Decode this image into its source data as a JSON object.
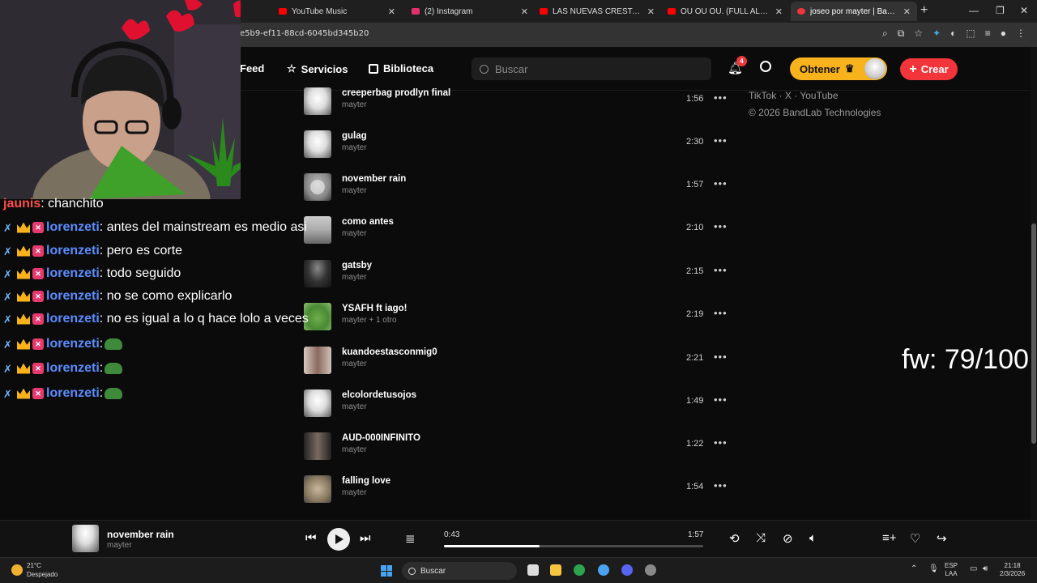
{
  "browser": {
    "tabs": [
      {
        "title": "YouTube Music",
        "color": "#ff0000"
      },
      {
        "title": "(2) Instagram",
        "color": "#e1306c"
      },
      {
        "title": "LAS NUEVAS CRESTAS (TEENX",
        "color": "#ff0000"
      },
      {
        "title": "OU OU OU. (FULL ALBUM) - Yo",
        "color": "#ff0000"
      },
      {
        "title": "joseo por mayter | BandLab",
        "color": "#f2353a"
      }
    ],
    "url": "e5b9-ef11-88cd-6045bd345b20"
  },
  "header": {
    "nav": {
      "feed": "Feed",
      "services": "Servicios",
      "library": "Biblioteca"
    },
    "search_placeholder": "Buscar",
    "notification_count": "4",
    "get_label": "Obtener",
    "create_label": "Crear"
  },
  "footer": {
    "links": "TikTok · X · YouTube",
    "copyright": "© 2026 BandLab Technologies"
  },
  "tracks": [
    {
      "name": "creeperbag prodlyn final",
      "artist": "mayter",
      "duration": "1:56"
    },
    {
      "name": "gulag",
      "artist": "mayter",
      "duration": "2:30"
    },
    {
      "name": "november rain",
      "artist": "mayter",
      "duration": "1:57"
    },
    {
      "name": "como antes",
      "artist": "mayter",
      "duration": "2:10"
    },
    {
      "name": "gatsby",
      "artist": "mayter",
      "duration": "2:15"
    },
    {
      "name": "YSAFH ft iago!",
      "artist": "mayter + 1 otro",
      "duration": "2:19"
    },
    {
      "name": "kuandoestasconmig0",
      "artist": "mayter",
      "duration": "2:21"
    },
    {
      "name": "elcolordetusojos",
      "artist": "mayter",
      "duration": "1:49"
    },
    {
      "name": "AUD-000INFINITO",
      "artist": "mayter",
      "duration": "1:22"
    },
    {
      "name": "falling love",
      "artist": "mayter",
      "duration": "1:54"
    }
  ],
  "overlay": {
    "fw": "fw: 79/100"
  },
  "chat": [
    {
      "user": "jaunis",
      "msg": ": chanchito",
      "badges": false,
      "emote": false
    },
    {
      "user": "lorenzeti",
      "msg": ": antes del mainstream es medio asi",
      "badges": true,
      "emote": false
    },
    {
      "user": "lorenzeti",
      "msg": ": pero es corte",
      "badges": true,
      "emote": false
    },
    {
      "user": "lorenzeti",
      "msg": ": todo seguido",
      "badges": true,
      "emote": false
    },
    {
      "user": "lorenzeti",
      "msg": ": no se como explicarlo",
      "badges": true,
      "emote": false
    },
    {
      "user": "lorenzeti",
      "msg": ": no es igual a lo q hace lolo a veces",
      "badges": true,
      "emote": false
    },
    {
      "user": "lorenzeti",
      "msg": ":",
      "badges": true,
      "emote": true
    },
    {
      "user": "lorenzeti",
      "msg": ":",
      "badges": true,
      "emote": true
    },
    {
      "user": "lorenzeti",
      "msg": ":",
      "badges": true,
      "emote": true
    }
  ],
  "player": {
    "title": "november rain",
    "artist": "mayter",
    "current_time": "0:43",
    "total_time": "1:57",
    "progress_fraction": 0.37
  },
  "taskbar": {
    "temp": "21°C",
    "weather": "Despejado",
    "search": "Buscar",
    "lang_top": "ESP",
    "lang_bottom": "LAA",
    "time": "21:18",
    "date": "2/3/2026"
  }
}
